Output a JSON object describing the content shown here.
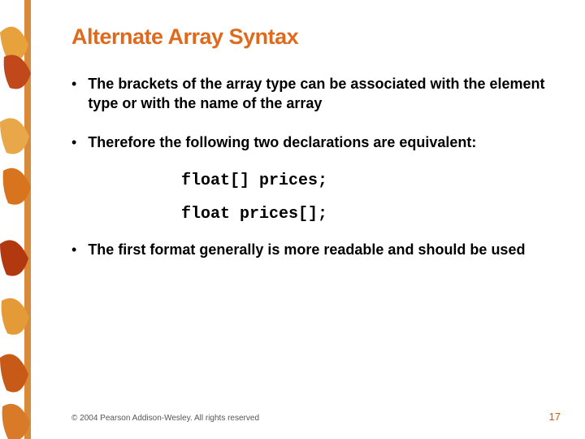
{
  "title": "Alternate Array Syntax",
  "bullets": {
    "b1": "The brackets of the array type can be associated with the element type or with the name of the array",
    "b2": "Therefore the following two declarations are equivalent:",
    "b3": "The first format generally is more readable and should be used"
  },
  "code": {
    "line1": "float[] prices;",
    "line2": "float prices[];"
  },
  "footer": {
    "copyright": "© 2004 Pearson Addison-Wesley. All rights reserved",
    "page": "17"
  }
}
